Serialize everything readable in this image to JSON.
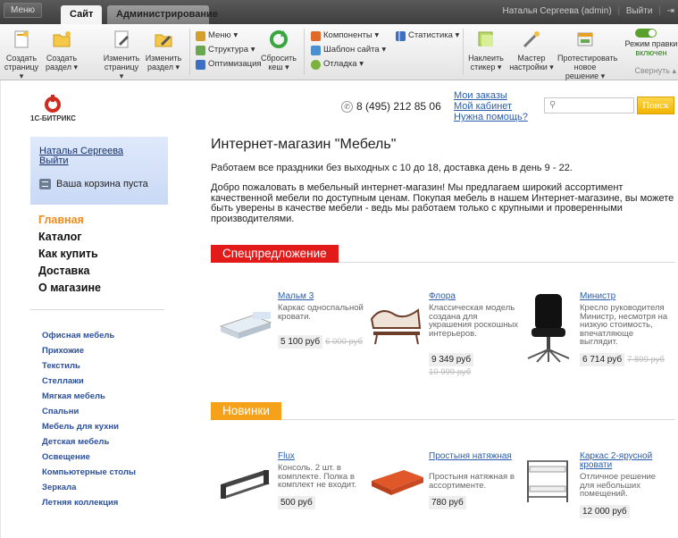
{
  "admin_bar": {
    "menu_label": "Меню",
    "tabs": [
      {
        "label": "Сайт",
        "active": true
      },
      {
        "label": "Администрирование",
        "active": false
      }
    ],
    "user_name": "Наталья Сергеева (admin)",
    "logout_label": "Выйти",
    "pin_label": "⇥"
  },
  "toolbar": {
    "buttons": [
      {
        "label": "Создать страницу",
        "arrow": "▾"
      },
      {
        "label": "Создать раздел",
        "arrow": "▾"
      },
      {
        "label": "Изменить страницу",
        "arrow": "▾"
      },
      {
        "label": "Изменить раздел",
        "arrow": "▾"
      }
    ],
    "list1": [
      "Меню ▾",
      "Структура ▾",
      "Оптимизация"
    ],
    "reset_cache": "Сбросить кеш ▾",
    "list2": [
      "Компоненты ▾",
      "Шаблон сайта ▾",
      "Отладка ▾"
    ],
    "statistics": "Статистика ▾",
    "sticker": "Наклеить стикер ▾",
    "wizard": "Мастер настройки ▾",
    "test_solution": "Протестировать новое решение ▾",
    "edit_mode_title": "Режим правки",
    "edit_mode_state": "включен",
    "collapse": "Свернуть ▴"
  },
  "header": {
    "logo_text": "1С-БИТРИКС",
    "phone": "8 (495) 212 85 06",
    "links": [
      "Мои заказы",
      "Мой кабинет",
      "Нужна помощь?"
    ],
    "search_placeholder": "",
    "search_button": "Поиск"
  },
  "sidebar": {
    "user_name": "Наталья Сергеева",
    "logout": "Выйти",
    "cart_text": "Ваша корзина пуста",
    "main_nav": [
      {
        "label": "Главная",
        "active": true
      },
      {
        "label": "Каталог",
        "active": false
      },
      {
        "label": "Как купить",
        "active": false
      },
      {
        "label": "Доставка",
        "active": false
      },
      {
        "label": "О магазине",
        "active": false
      }
    ],
    "categories": [
      "Офисная мебель",
      "Прихожие",
      "Текстиль",
      "Стеллажи",
      "Мягкая мебель",
      "Спальни",
      "Мебель для кухни",
      "Детская мебель",
      "Освещение",
      "Компьютерные столы",
      "Зеркала",
      "Летняя коллекция"
    ]
  },
  "main": {
    "title": "Интернет-магазин \"Мебель\"",
    "intro1": "Работаем все праздники без выходных с 10 до 18, доставка день в день 9 - 22.",
    "intro2": "Добро пожаловать в мебельный интернет-магазин! Мы предлагаем широкий ассортимент качественной мебели по доступным ценам. Покупая мебель в нашем Интернет-магазине, вы можете быть уверены в качестве мебели - ведь мы работаем только с крупными и проверенными производителями.",
    "special_label": "Спецпредложение",
    "new_label": "Новинки",
    "special_products": [
      {
        "name": "Мальм 3",
        "desc": "Каркас односпальной кровати.",
        "price": "5 100 руб",
        "old_price": "6 000 руб"
      },
      {
        "name": "Флора",
        "desc": "Классическая модель создана для украшения роскошных интерьеров.",
        "price": "9 349 руб",
        "old_price": "10 999 руб"
      },
      {
        "name": "Министр",
        "desc": "Кресло руководителя Министр, несмотря на низкую стоимость, впечатляюще выглядит.",
        "price": "6 714 руб",
        "old_price": "7 899 руб"
      }
    ],
    "new_products": [
      {
        "name": "Flux",
        "desc": "Консоль. 2 шт. в комплекте. Полка в комплект не входит.",
        "price": "500 руб"
      },
      {
        "name": "Простыня натяжная",
        "desc": "Простыня натяжная в ассортименте.",
        "price": "780 руб"
      },
      {
        "name": "Каркас 2-ярусной кровати",
        "desc": "Отличное решение для небольших помещений.",
        "price": "12 000 руб"
      }
    ]
  },
  "colors": {
    "accent_orange": "#f28a18",
    "sale_red": "#e31a1a",
    "new_orange": "#f5a21a",
    "link_blue": "#2a5dac",
    "search_yellow": "#f0b300"
  }
}
